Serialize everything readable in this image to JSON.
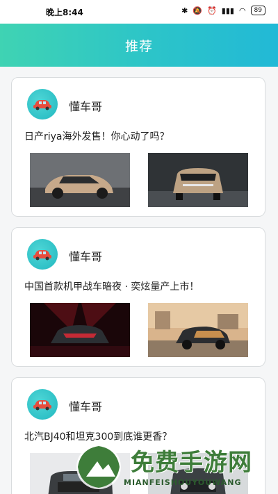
{
  "status_bar": {
    "time": "晚上8:44",
    "battery": "89"
  },
  "header": {
    "title": "推荐"
  },
  "posts": [
    {
      "author": "懂车哥",
      "title": "日产riya海外发售！你心动了吗？"
    },
    {
      "author": "懂车哥",
      "title": "中国首款机甲战车暗夜 · 奕炫量产上市！"
    },
    {
      "author": "懂车哥",
      "title": "北汽BJ40和坦克300到底谁更香？"
    }
  ],
  "watermark": {
    "title": "免费手游网",
    "subtitle": "MIANFEISHOUYOUWANG"
  },
  "colors": {
    "header_start": "#3fd3b3",
    "header_end": "#22b9d6",
    "avatar": "#2cc4c9"
  }
}
